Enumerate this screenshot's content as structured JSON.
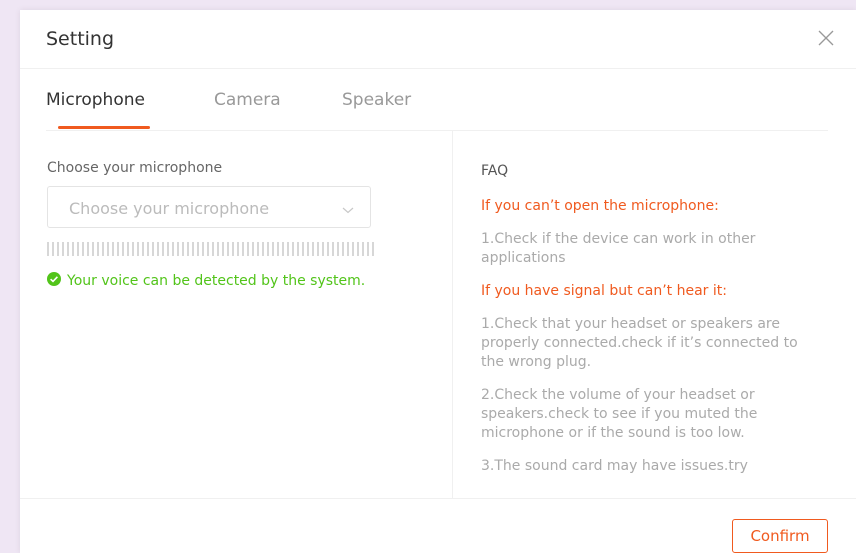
{
  "dialog": {
    "title": "Setting",
    "close_icon": "close-icon"
  },
  "tabs": [
    {
      "label": "Microphone",
      "active": true
    },
    {
      "label": "Camera",
      "active": false
    },
    {
      "label": "Speaker",
      "active": false
    }
  ],
  "microphone": {
    "label": "Choose your microphone",
    "select_placeholder": "Choose your microphone",
    "status_text": "Your voice can be detected by the system.",
    "status_icon": "check-circle-icon"
  },
  "faq": {
    "title": "FAQ",
    "q1": "If you can’t open the microphone:",
    "a1": "1.Check if the device can work in other applications",
    "q2": "If you have signal but can’t hear it:",
    "a2_1": "1.Check that your headset or speakers are properly connected.check if it’s connected to the wrong plug.",
    "a2_2": "2.Check the volume of your headset or speakers.check to see if you muted the microphone or if the sound is too low.",
    "a2_3": "3.The sound card may have issues.try"
  },
  "footer": {
    "confirm_label": "Confirm"
  },
  "colors": {
    "accent": "#f05a1f",
    "success": "#52c41a",
    "background": "#efe6f4"
  }
}
